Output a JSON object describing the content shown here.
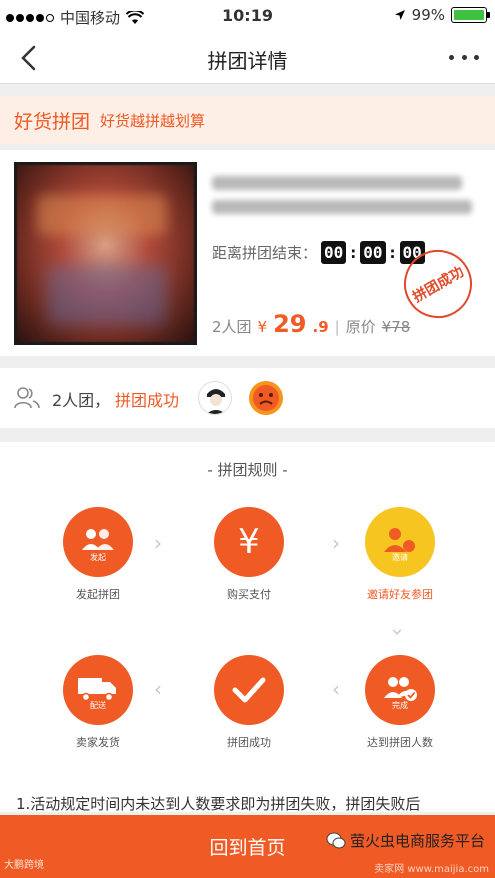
{
  "status_bar": {
    "carrier": "中国移动",
    "time": "10:19",
    "battery_percent": "99%",
    "battery_level": 0.99
  },
  "nav": {
    "title": "拼团详情"
  },
  "promo": {
    "title": "好货拼团",
    "subtitle": "好货越拼越划算"
  },
  "product": {
    "countdown_label": "距离拼团结束：",
    "countdown": [
      "00",
      "00",
      "00"
    ],
    "group_size_label": "2人团",
    "currency": "¥",
    "price_main": "29",
    "price_decimal": ".9",
    "orig_label": "原价",
    "orig_price": "¥78",
    "stamp_text": "拼团成功"
  },
  "group": {
    "size_text": "2人团，",
    "status_text": "拼团成功"
  },
  "rules": {
    "title": "- 拼团规则 -",
    "steps": [
      {
        "label": "发起拼团",
        "icon_text": "发起",
        "highlight": false
      },
      {
        "label": "购买支付",
        "icon_text": "¥",
        "highlight": false
      },
      {
        "label": "邀请好友参团",
        "icon_text": "邀请",
        "highlight": true
      },
      {
        "label": "卖家发货",
        "icon_text": "配送",
        "highlight": false
      },
      {
        "label": "拼团成功",
        "icon_text": "",
        "highlight": false
      },
      {
        "label": "达到拼团人数",
        "icon_text": "完成",
        "highlight": false
      }
    ],
    "text": "1.活动规定时间内未达到人数要求即为拼团失败，拼团失败后"
  },
  "footer": {
    "home_label": "回到首页"
  },
  "watermark": {
    "left": "大鹏跨境",
    "right": "萤火虫电商服务平台",
    "right_sub": "卖家网 www.maijia.com"
  },
  "colors": {
    "accent": "#f05a24",
    "yellow": "#f7c520",
    "banner_bg": "#fdeee6"
  }
}
